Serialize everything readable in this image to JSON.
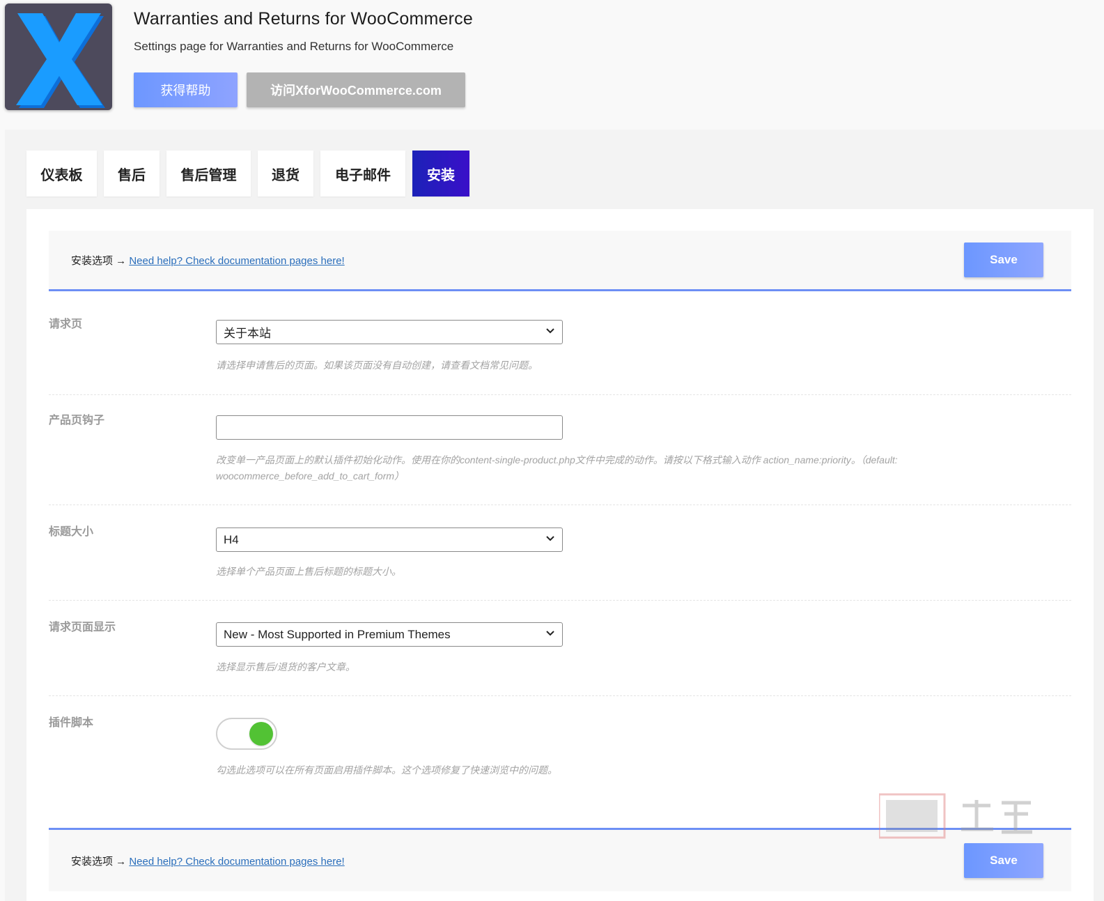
{
  "header": {
    "title": "Warranties and Returns for WooCommerce",
    "subtitle": "Settings page for Warranties and Returns for WooCommerce",
    "help_button": "获得帮助",
    "visit_button": "访问XforWooCommerce.com",
    "logo_icon": "x-logo-icon"
  },
  "tabs": [
    {
      "label": "仪表板",
      "active": false
    },
    {
      "label": "售后",
      "active": false
    },
    {
      "label": "售后管理",
      "active": false
    },
    {
      "label": "退货",
      "active": false
    },
    {
      "label": "电子邮件",
      "active": false
    },
    {
      "label": "安装",
      "active": true
    }
  ],
  "section_bar": {
    "prefix": "安装选项 →",
    "link": "Need help? Check documentation pages here!",
    "save": "Save"
  },
  "fields": {
    "request_page": {
      "label": "请求页",
      "value": "关于本站",
      "hint": "请选择申请售后的页面。如果该页面没有自动创建，请查看文档常见问题。"
    },
    "product_hook": {
      "label": "产品页钩子",
      "value": "",
      "hint": "改变单一产品页面上的默认插件初始化动作。使用在你的content-single-product.php文件中完成的动作。请按以下格式输入动作 action_name:priority。（default: woocommerce_before_add_to_cart_form）"
    },
    "title_size": {
      "label": "标题大小",
      "value": "H4",
      "hint": "选择单个产品页面上售后标题的标题大小。"
    },
    "request_display": {
      "label": "请求页面显示",
      "value": "New - Most Supported in Premium Themes",
      "hint": "选择显示售后/退货的客户文章。"
    },
    "plugin_scripts": {
      "label": "插件脚本",
      "enabled": true,
      "hint": "勾选此选项可以在所有页面启用插件脚本。这个选项修复了快速浏览中的问题。"
    }
  },
  "colors": {
    "accent": "#6d8ff5",
    "active_tab": "#2a18c0",
    "toggle_on": "#52c234",
    "logo_bg": "#4d4a5c",
    "logo_x": "#1a9cff"
  }
}
